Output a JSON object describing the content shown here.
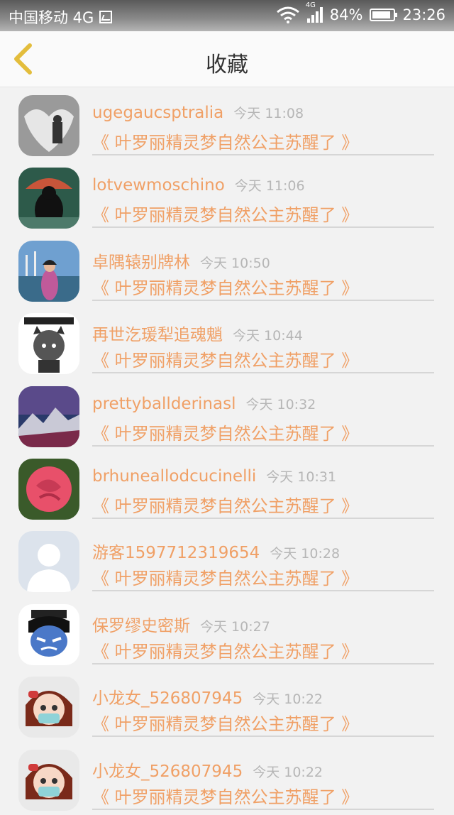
{
  "status_bar": {
    "carrier": "中国移动 4G",
    "network_tag": "4G",
    "battery": "84%",
    "time": "23:26"
  },
  "header": {
    "title": "收藏",
    "back_icon": "chevron-left-icon"
  },
  "accent_color": "#f0a066",
  "items": [
    {
      "name": "ugegaucsptralia",
      "time": "今天 11:08",
      "post": "《 叶罗丽精灵梦自然公主苏醒了 》"
    },
    {
      "name": "lotvewmoschino",
      "time": "今天 11:06",
      "post": "《 叶罗丽精灵梦自然公主苏醒了 》"
    },
    {
      "name": "卓隅辕别牌林",
      "time": "今天 10:50",
      "post": "《 叶罗丽精灵梦自然公主苏醒了 》"
    },
    {
      "name": "再世汔瑗犁追魂魈",
      "time": "今天 10:44",
      "post": "《 叶罗丽精灵梦自然公主苏醒了 》"
    },
    {
      "name": "prettyballderinasl",
      "time": "今天 10:32",
      "post": "《 叶罗丽精灵梦自然公主苏醒了 》"
    },
    {
      "name": "brhuneallodcucinelli",
      "time": "今天 10:31",
      "post": "《 叶罗丽精灵梦自然公主苏醒了 》"
    },
    {
      "name": "游客1597712319654",
      "time": "今天 10:28",
      "post": "《 叶罗丽精灵梦自然公主苏醒了 》"
    },
    {
      "name": "保罗缪史密斯",
      "time": "今天 10:27",
      "post": "《 叶罗丽精灵梦自然公主苏醒了 》"
    },
    {
      "name": "小龙女_526807945",
      "time": "今天 10:22",
      "post": "《 叶罗丽精灵梦自然公主苏醒了 》"
    },
    {
      "name": "小龙女_526807945",
      "time": "今天 10:22",
      "post": "《 叶罗丽精灵梦自然公主苏醒了 》"
    }
  ]
}
